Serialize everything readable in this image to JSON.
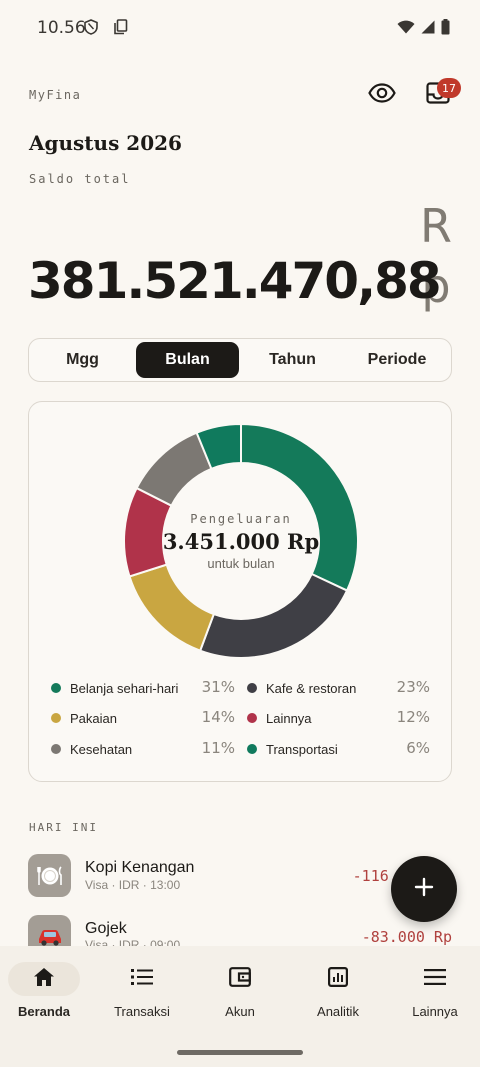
{
  "status": {
    "time": "10.56"
  },
  "header": {
    "app_name": "MyFina",
    "inbox_badge": "17"
  },
  "summary": {
    "month": "Agustus 2026",
    "saldo_label": "Saldo total",
    "balance": "381.521.470,88",
    "currency": "Rp"
  },
  "period_tabs": [
    {
      "label": "Mgg",
      "active": false
    },
    {
      "label": "Bulan",
      "active": true
    },
    {
      "label": "Tahun",
      "active": false
    },
    {
      "label": "Periode",
      "active": false
    }
  ],
  "chart_data": {
    "type": "pie",
    "center_label": "Pengeluaran",
    "center_value": "3.451.000 Rp",
    "center_sub": "untuk bulan",
    "categories": [
      "Belanja sehari-hari",
      "Kafe & restoran",
      "Pakaian",
      "Lainnya",
      "Kesehatan",
      "Transportasi"
    ],
    "values": [
      31,
      23,
      14,
      12,
      11,
      6
    ],
    "labels": [
      "31%",
      "23%",
      "14%",
      "12%",
      "11%",
      "6%"
    ],
    "colors": [
      "#147a5a",
      "#3f3f45",
      "#c9a641",
      "#b0334a",
      "#7c7873",
      "#107a5d"
    ]
  },
  "today": {
    "section_label": "HARI INI",
    "transactions": [
      {
        "icon": "plate-icon",
        "title": "Kopi Kenangan",
        "sub": "Visa · IDR · 13:00",
        "amount": "-116.000 Rp"
      },
      {
        "icon": "car-icon",
        "title": "Gojek",
        "sub": "Visa · IDR · 09:00",
        "amount": "-83.000 Rp"
      }
    ]
  },
  "nav": [
    {
      "label": "Beranda",
      "icon": "home-icon",
      "active": true
    },
    {
      "label": "Transaksi",
      "icon": "list-icon",
      "active": false
    },
    {
      "label": "Akun",
      "icon": "wallet-icon",
      "active": false
    },
    {
      "label": "Analitik",
      "icon": "chart-icon",
      "active": false
    },
    {
      "label": "Lainnya",
      "icon": "menu-icon",
      "active": false
    }
  ]
}
